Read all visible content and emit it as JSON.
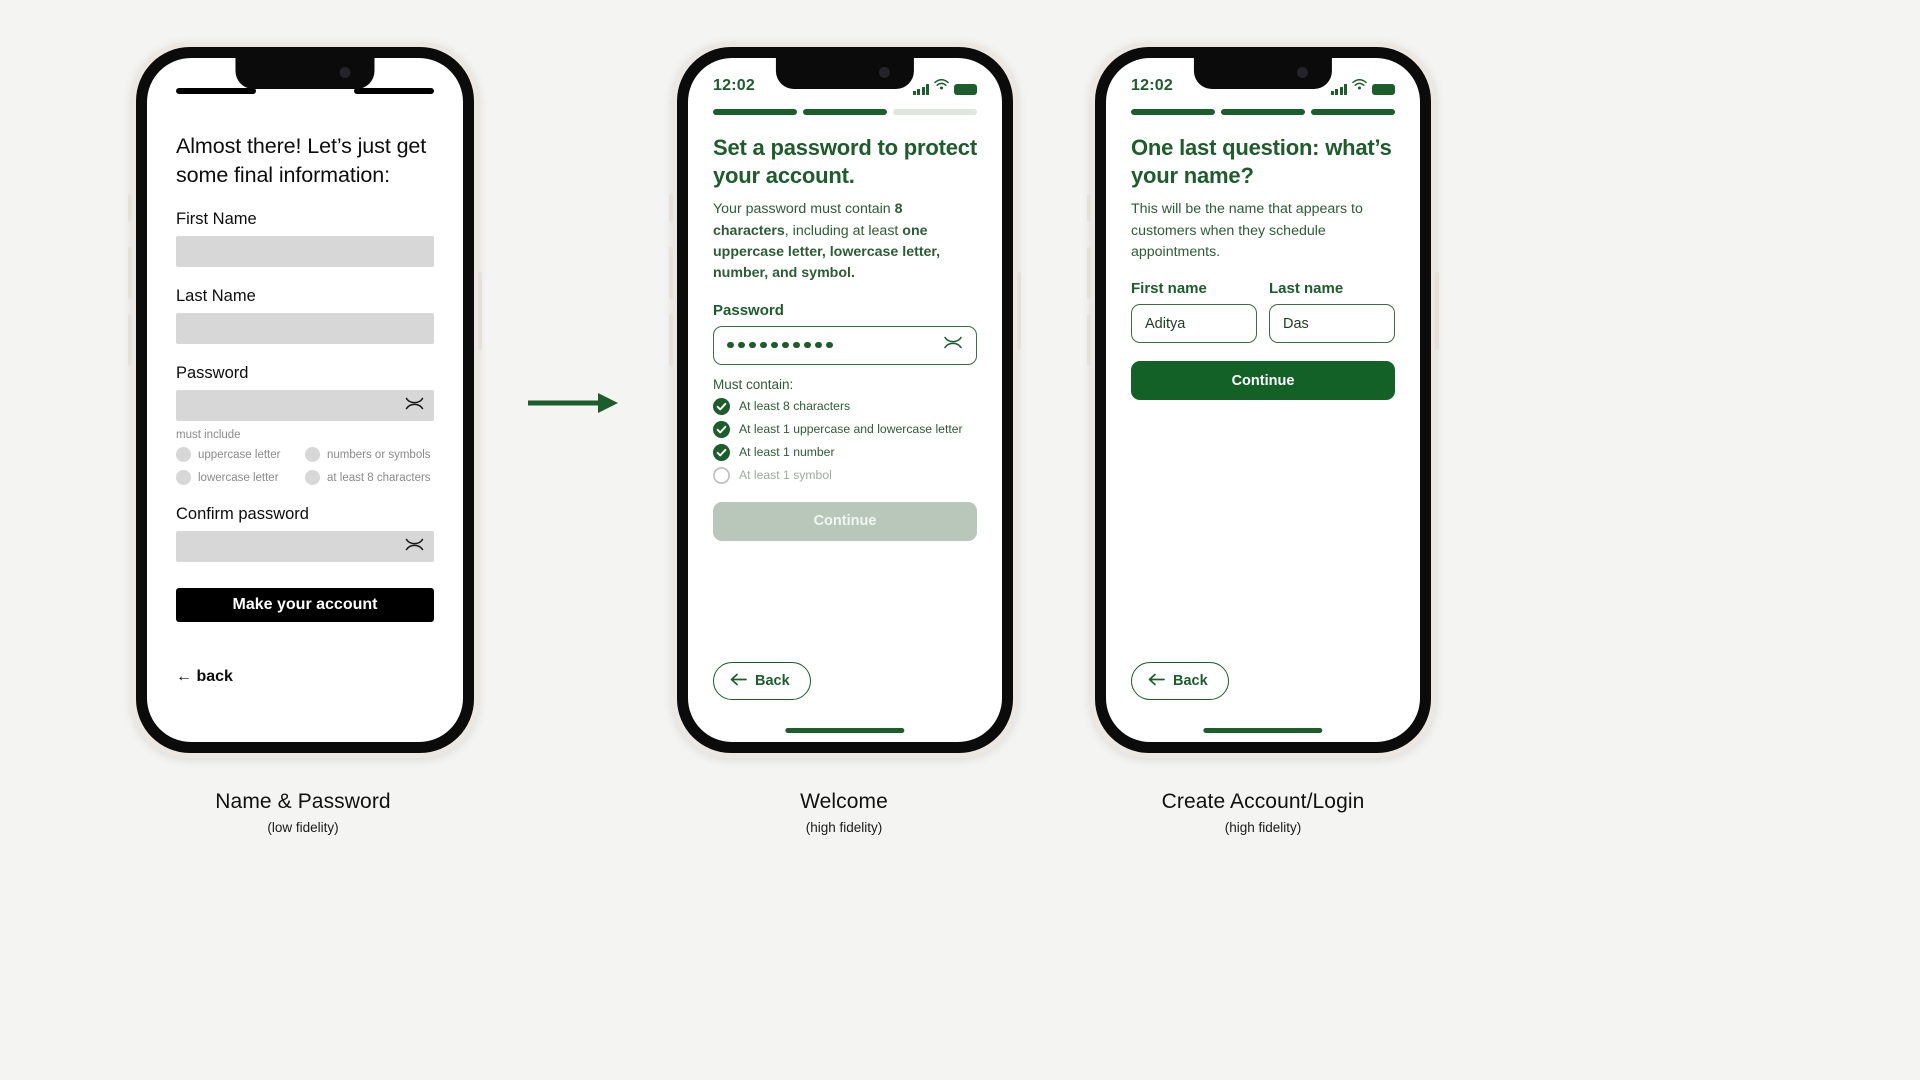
{
  "theme": {
    "green": "#1d5c2b",
    "green_dark": "#174a23",
    "page_bg": "#f4f4f2",
    "lofi_gray": "#d7d7d7",
    "lofi_text_gray": "#8a8a8a",
    "disabled_btn": "#b8c7ba"
  },
  "screens": [
    {
      "id": "name-password",
      "fidelity": "(low fidelity)",
      "caption": "Name & Password",
      "heading": "Almost there! Let’s just get some final information:",
      "fields": [
        {
          "label": "First Name",
          "value": ""
        },
        {
          "label": "Last Name",
          "value": ""
        },
        {
          "label": "Password",
          "value": ""
        },
        {
          "label": "Confirm password",
          "value": ""
        }
      ],
      "must_include_label": "must include",
      "requirements": [
        "uppercase letter",
        "numbers or symbols",
        "lowercase letter",
        "at least 8 characters"
      ],
      "cta": "Make your account",
      "back": "← back"
    },
    {
      "id": "welcome",
      "fidelity": "(high fidelity)",
      "caption": "Welcome",
      "status": {
        "time": "12:02"
      },
      "progress": {
        "total": 3,
        "filled": 2
      },
      "heading": "Set a password to protect your account.",
      "body_parts": [
        {
          "text": "Your password must contain ",
          "bold": false
        },
        {
          "text": "8 characters",
          "bold": true
        },
        {
          "text": ", including at least ",
          "bold": false
        },
        {
          "text": "one uppercase letter, lowercase letter, number, and symbol.",
          "bold": true
        }
      ],
      "password_label": "Password",
      "password_dots": 10,
      "must_contain_label": "Must contain:",
      "checks": [
        {
          "label": "At least 8 characters",
          "done": true
        },
        {
          "label": "At least 1 uppercase and lowercase letter",
          "done": true
        },
        {
          "label": "At least 1 number",
          "done": true
        },
        {
          "label": "At least 1 symbol",
          "done": false
        }
      ],
      "cta": "Continue",
      "cta_enabled": false,
      "back": "Back"
    },
    {
      "id": "create-account-login",
      "fidelity": "(high fidelity)",
      "caption": "Create Account/Login",
      "status": {
        "time": "12:02"
      },
      "progress": {
        "total": 3,
        "filled": 3
      },
      "heading": "One last question: what’s your name?",
      "body": "This will be the name that appears to customers when they schedule appointments.",
      "fields": [
        {
          "label": "First name",
          "value": "Aditya"
        },
        {
          "label": "Last name",
          "value": "Das"
        }
      ],
      "cta": "Continue",
      "cta_enabled": true,
      "back": "Back"
    }
  ]
}
